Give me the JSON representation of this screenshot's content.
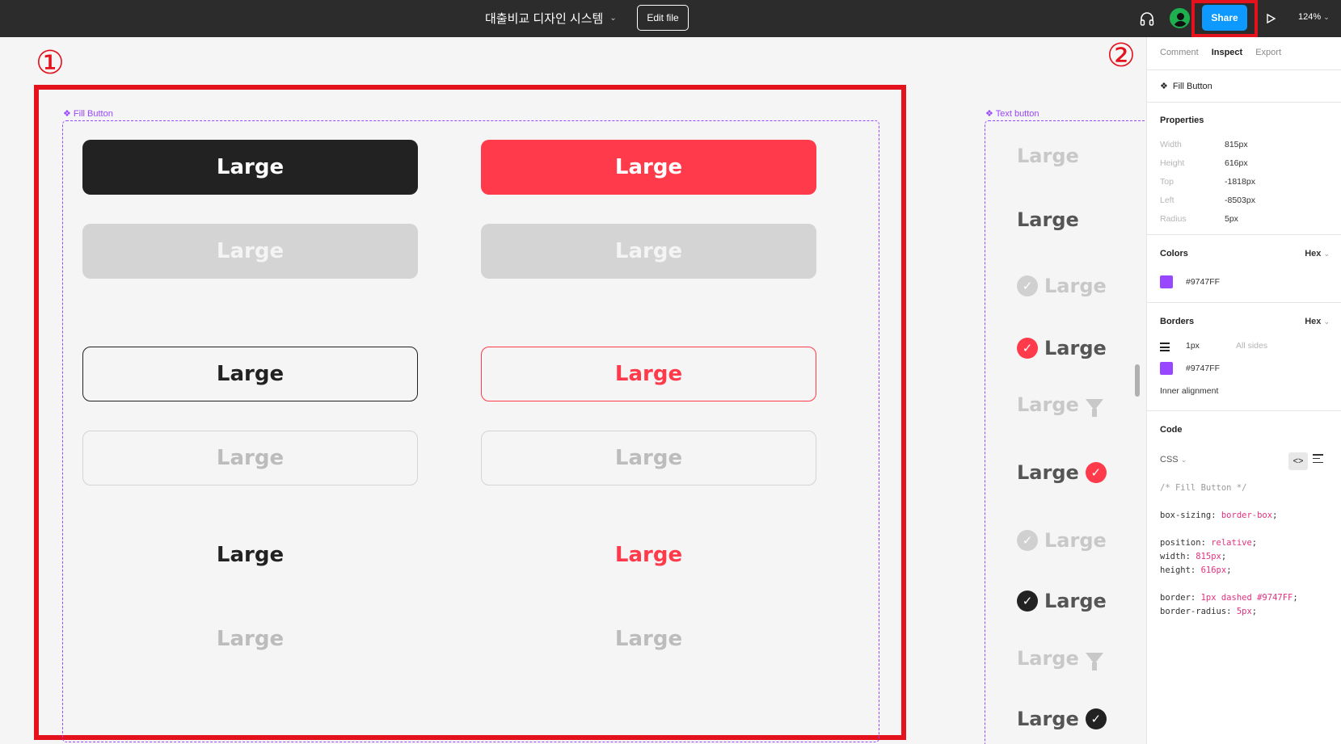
{
  "topbar": {
    "file_title": "대출비교 디자인 시스템",
    "edit_label": "Edit file",
    "share_label": "Share",
    "zoom": "124%",
    "icons": [
      "headphones-icon",
      "avatar",
      "play-icon",
      "chevron-down-icon"
    ]
  },
  "annotations": {
    "marker1": "①",
    "marker2": "②",
    "highlight_color": "#e3121d"
  },
  "canvas": {
    "fill_frame_label": "Fill Button",
    "text_frame_label": "Text button",
    "frame_color": "#9747ff",
    "fill_buttons": [
      {
        "label": "Large",
        "style": "filled-dark"
      },
      {
        "label": "Large",
        "style": "filled-red"
      },
      {
        "label": "Large",
        "style": "filled-disabled"
      },
      {
        "label": "Large",
        "style": "filled-disabled"
      },
      {
        "label": "Large",
        "style": "outline-dark"
      },
      {
        "label": "Large",
        "style": "outline-red"
      },
      {
        "label": "Large",
        "style": "outline-disabled"
      },
      {
        "label": "Large",
        "style": "outline-disabled"
      },
      {
        "label": "Large",
        "style": "text-dark"
      },
      {
        "label": "Large",
        "style": "text-red"
      },
      {
        "label": "Large",
        "style": "text-disabled"
      },
      {
        "label": "Large",
        "style": "text-disabled"
      }
    ],
    "text_buttons": [
      {
        "label": "Large",
        "icon": "none",
        "state": "disabled"
      },
      {
        "label": "Large",
        "icon": "none",
        "state": "default"
      },
      {
        "label": "Large",
        "icon": "check-circle-icon",
        "state": "disabled"
      },
      {
        "label": "Large",
        "icon": "check-circle-icon",
        "state": "active-red"
      },
      {
        "label": "Large",
        "icon": "filter-icon",
        "state": "disabled"
      },
      {
        "label": "Large",
        "icon": "check-circle-icon",
        "state": "active-red"
      },
      {
        "label": "Large",
        "icon": "check-circle-icon",
        "state": "disabled"
      },
      {
        "label": "Large",
        "icon": "check-circle-icon",
        "state": "active-dark"
      },
      {
        "label": "Large",
        "icon": "filter-icon",
        "state": "disabled"
      },
      {
        "label": "Large",
        "icon": "check-circle-icon",
        "state": "active-dark"
      }
    ]
  },
  "panel": {
    "tabs": [
      {
        "label": "Comment"
      },
      {
        "label": "Inspect"
      },
      {
        "label": "Export"
      }
    ],
    "active_tab": "Inspect",
    "component_name": "Fill Button",
    "properties_title": "Properties",
    "properties": [
      {
        "key": "Width",
        "value": "815px"
      },
      {
        "key": "Height",
        "value": "616px"
      },
      {
        "key": "Top",
        "value": "-1818px"
      },
      {
        "key": "Left",
        "value": "-8503px"
      },
      {
        "key": "Radius",
        "value": "5px"
      }
    ],
    "colors_title": "Colors",
    "colors_format": "Hex",
    "color_value": "#9747FF",
    "borders_title": "Borders",
    "borders_format": "Hex",
    "border_width": "1px",
    "border_sides": "All sides",
    "border_color": "#9747FF",
    "inner_alignment": "Inner alignment",
    "code_title": "Code",
    "code_lang": "CSS",
    "code": {
      "comment": "/* Fill Button */",
      "l1k": "box-sizing: ",
      "l1v": "border-box",
      "l1e": ";",
      "l2k": "position: ",
      "l2v": "relative",
      "l2e": ";",
      "l3k": "width: ",
      "l3v": "815px",
      "l3e": ";",
      "l4k": "height: ",
      "l4v": "616px",
      "l4e": ";",
      "l5k": "border: ",
      "l5v": "1px dashed #9747FF",
      "l5e": ";",
      "l6k": "border-radius: ",
      "l6v": "5px",
      "l6e": ";"
    }
  }
}
